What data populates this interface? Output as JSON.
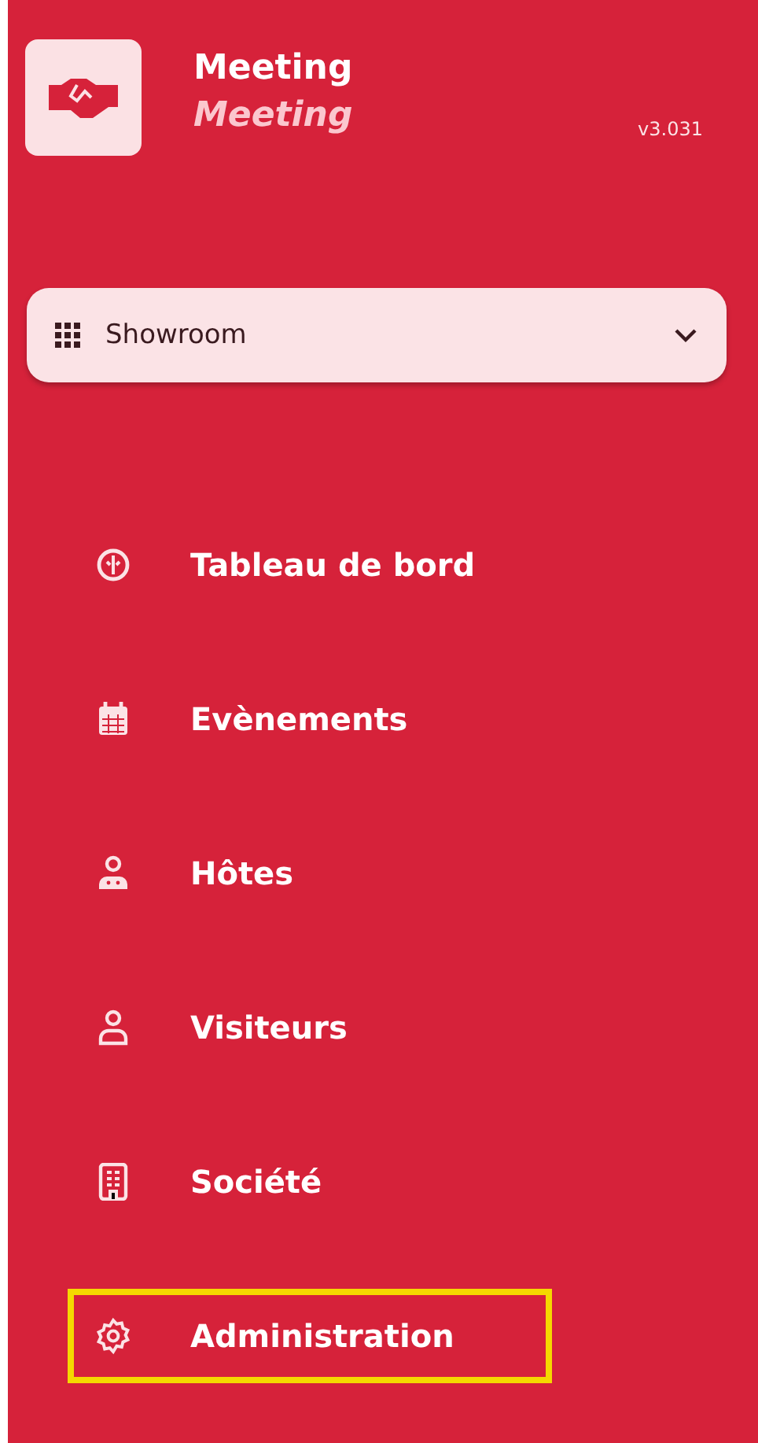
{
  "brand": {
    "title": "Meeting",
    "subtitle": "Meeting",
    "version": "v3.031"
  },
  "workspace_select": {
    "value": "Showroom"
  },
  "nav": {
    "items": [
      {
        "label": "Tableau de bord",
        "highlighted": false
      },
      {
        "label": "Evènements",
        "highlighted": false
      },
      {
        "label": "Hôtes",
        "highlighted": false
      },
      {
        "label": "Visiteurs",
        "highlighted": false
      },
      {
        "label": "Société",
        "highlighted": false
      },
      {
        "label": "Administration",
        "highlighted": true
      }
    ]
  }
}
